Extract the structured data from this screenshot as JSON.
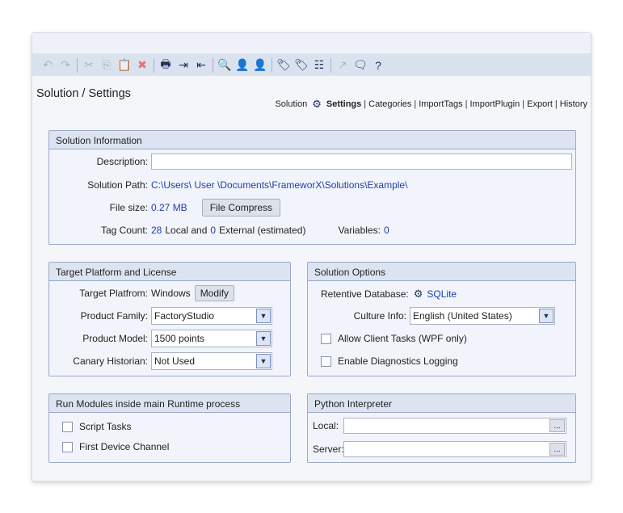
{
  "toolbar": {
    "icons": [
      {
        "name": "undo-icon",
        "glyph": "↶",
        "enabled": false
      },
      {
        "name": "redo-icon",
        "glyph": "↷",
        "enabled": false
      },
      {
        "name": "cut-icon",
        "glyph": "✂",
        "enabled": false
      },
      {
        "name": "copy-icon",
        "glyph": "⎘",
        "enabled": false
      },
      {
        "name": "paste-icon",
        "glyph": "📋",
        "enabled": false
      },
      {
        "name": "delete-icon",
        "glyph": "✖",
        "enabled": false
      },
      {
        "name": "print-icon",
        "glyph": "🖶",
        "enabled": true
      },
      {
        "name": "import-icon",
        "glyph": "⇥",
        "enabled": true
      },
      {
        "name": "export-icon",
        "glyph": "⇤",
        "enabled": true
      },
      {
        "name": "search-icon",
        "glyph": "🔍",
        "enabled": true
      },
      {
        "name": "user-add-icon",
        "glyph": "👤",
        "enabled": false
      },
      {
        "name": "user-remove-icon",
        "glyph": "👤",
        "enabled": false
      },
      {
        "name": "tag-icon",
        "glyph": "🏷",
        "enabled": true
      },
      {
        "name": "tags-icon",
        "glyph": "🏷",
        "enabled": true
      },
      {
        "name": "tree-icon",
        "glyph": "☷",
        "enabled": true
      },
      {
        "name": "external-link-icon",
        "glyph": "↗",
        "enabled": false
      },
      {
        "name": "comment-icon",
        "glyph": "🗨",
        "enabled": true
      },
      {
        "name": "help-icon",
        "glyph": "?",
        "enabled": true
      }
    ]
  },
  "page": {
    "title": "Solution / Settings"
  },
  "nav": {
    "solution": "Solution",
    "settings": "Settings",
    "categories": "Categories",
    "import_tags": "ImportTags",
    "import_plugin": "ImportPlugin",
    "export": "Export",
    "history": "History"
  },
  "solution_info": {
    "header": "Solution Information",
    "description_label": "Description:",
    "description_value": "",
    "path_label": "Solution Path:",
    "path_value": "C:\\Users\\  User  \\Documents\\FrameworX\\Solutions\\Example\\",
    "filesize_label": "File size:",
    "filesize_value": "0.27 MB",
    "compress_button": "File Compress",
    "tagcount_label": "Tag Count:",
    "tag_local_count": "28",
    "tag_local_text": "Local and",
    "tag_external_count": "0",
    "tag_external_text": "External (estimated)",
    "variables_label": "Variables:",
    "variables_value": "0"
  },
  "target_platform": {
    "header": "Target Platform and License",
    "platform_label": "Target Platfrom:",
    "platform_value": "Windows",
    "modify_button": "Modify",
    "family_label": "Product Family:",
    "family_value": "FactoryStudio",
    "model_label": "Product Model:",
    "model_value": "1500 points",
    "historian_label": "Canary Historian:",
    "historian_value": "Not Used"
  },
  "solution_options": {
    "header": "Solution Options",
    "retentive_label": "Retentive Database:",
    "retentive_value": "SQLite",
    "culture_label": "Culture Info:",
    "culture_value": "English (United States)",
    "allow_client_tasks": "Allow Client Tasks (WPF only)",
    "enable_diagnostics": "Enable Diagnostics Logging"
  },
  "run_modules": {
    "header": "Run Modules inside main Runtime process",
    "script_tasks": "Script Tasks",
    "first_device_channel": "First Device Channel"
  },
  "python": {
    "header": "Python Interpreter",
    "local_label": "Local:",
    "local_value": "",
    "server_label": "Server:",
    "server_value": "",
    "browse_button": "..."
  }
}
